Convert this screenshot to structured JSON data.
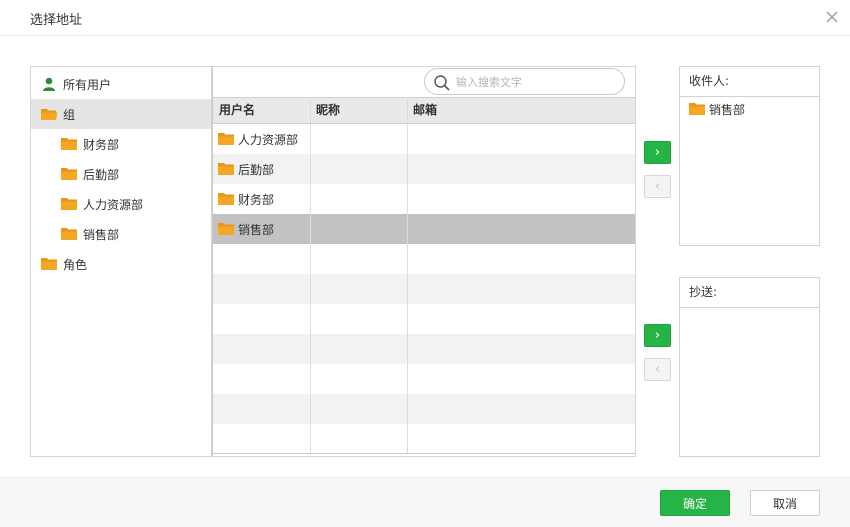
{
  "dialog": {
    "title": "选择地址",
    "close_icon": "close-icon"
  },
  "tree": {
    "items": [
      {
        "label": "所有用户",
        "icon": "user-icon"
      },
      {
        "label": "组",
        "icon": "folder-open-icon",
        "selected": true
      },
      {
        "label": "财务部",
        "icon": "folder-icon"
      },
      {
        "label": "后勤部",
        "icon": "folder-icon"
      },
      {
        "label": "人力资源部",
        "icon": "folder-icon"
      },
      {
        "label": "销售部",
        "icon": "folder-icon"
      },
      {
        "label": "角色",
        "icon": "folder-icon"
      }
    ]
  },
  "search": {
    "placeholder": "输入搜索文字",
    "value": "",
    "icon": "search-icon"
  },
  "table": {
    "columns": [
      "用户名",
      "昵称",
      "邮箱"
    ],
    "rows": [
      {
        "name": "人力资源部",
        "nickname": "",
        "email": ""
      },
      {
        "name": "后勤部",
        "nickname": "",
        "email": ""
      },
      {
        "name": "财务部",
        "nickname": "",
        "email": ""
      },
      {
        "name": "销售部",
        "nickname": "",
        "email": "",
        "selected": true
      }
    ]
  },
  "transfer": {
    "add_label": "›",
    "remove_label": "‹"
  },
  "recipients": {
    "to_label": "收件人:",
    "to_items": [
      "销售部"
    ],
    "cc_label": "抄送:",
    "cc_items": []
  },
  "footer": {
    "ok_label": "确定",
    "cancel_label": "取消"
  },
  "colors": {
    "accent": "#27b446",
    "folder": "#f5a623",
    "user": "#2f8a3c",
    "selected_row": "#c2c2c2",
    "selected_tree": "#e4e4e4"
  }
}
